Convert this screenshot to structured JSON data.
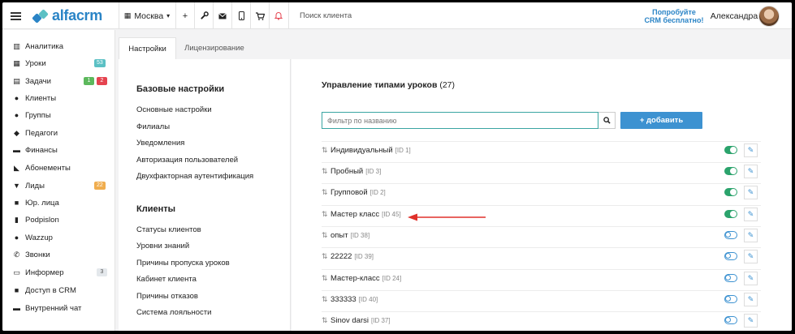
{
  "header": {
    "logo_text": "alfacrm",
    "branch": "Москва",
    "branch_caret": "▾",
    "plus": "+",
    "search_placeholder": "Поиск клиента",
    "promo_line1": "Попробуйте",
    "promo_line2": "CRM бесплатно!",
    "user_name": "Александра"
  },
  "sidebar": {
    "items": [
      {
        "label": "Аналитика",
        "icon": "analytics-icon",
        "glyph": "▥"
      },
      {
        "label": "Уроки",
        "icon": "calendar-icon",
        "glyph": "▦",
        "badge": "53"
      },
      {
        "label": "Задачи",
        "icon": "tasks-icon",
        "glyph": "▤",
        "badge1": "1",
        "badge2": "2"
      },
      {
        "label": "Клиенты",
        "icon": "user-icon",
        "glyph": "●"
      },
      {
        "label": "Группы",
        "icon": "users-icon",
        "glyph": "●"
      },
      {
        "label": "Педагоги",
        "icon": "graduation-cap-icon",
        "glyph": "◆"
      },
      {
        "label": "Финансы",
        "icon": "money-icon",
        "glyph": "▬"
      },
      {
        "label": "Абонементы",
        "icon": "tag-icon",
        "glyph": "◣"
      },
      {
        "label": "Лиды",
        "icon": "funnel-icon",
        "glyph": "▼",
        "badge": "22"
      },
      {
        "label": "Юр. лица",
        "icon": "briefcase-icon",
        "glyph": "■"
      },
      {
        "label": "Podpislon",
        "icon": "document-icon",
        "glyph": "▮"
      },
      {
        "label": "Wazzup",
        "icon": "whatsapp-icon",
        "glyph": "●"
      },
      {
        "label": "Звонки",
        "icon": "phone-icon",
        "glyph": "✆"
      },
      {
        "label": "Информер",
        "icon": "informer-icon",
        "glyph": "▭",
        "badge": "3"
      },
      {
        "label": "Доступ в CRM",
        "icon": "lock-icon",
        "glyph": "■"
      },
      {
        "label": "Внутренний чат",
        "icon": "chat-icon",
        "glyph": "▬"
      }
    ]
  },
  "tabs": [
    {
      "label": "Настройки"
    },
    {
      "label": "Лицензирование"
    }
  ],
  "settings": {
    "base_title": "Базовые настройки",
    "base_links": [
      "Основные настройки",
      "Филиалы",
      "Уведомления",
      "Авторизация пользователей",
      "Двухфакторная аутентификация"
    ],
    "clients_title": "Клиенты",
    "clients_links": [
      "Статусы клиентов",
      "Уровни знаний",
      "Причины пропуска уроков",
      "Кабинет клиента",
      "Причины отказов",
      "Система лояльности"
    ]
  },
  "content": {
    "title": "Управление типами уроков",
    "count": "(27)",
    "filter_placeholder": "Фильтр по названию",
    "add_label": "+ добавить",
    "rows": [
      {
        "name": "Индивидуальный",
        "id": "[ID 1]",
        "active": true
      },
      {
        "name": "Пробный",
        "id": "[ID 3]",
        "active": true
      },
      {
        "name": "Групповой",
        "id": "[ID 2]",
        "active": true
      },
      {
        "name": "Мастер класс",
        "id": "[ID 45]",
        "active": true
      },
      {
        "name": "опыт",
        "id": "[ID 38]",
        "active": false
      },
      {
        "name": "22222",
        "id": "[ID 39]",
        "active": false
      },
      {
        "name": "Мастер-класс",
        "id": "[ID 24]",
        "active": false
      },
      {
        "name": "333333",
        "id": "[ID 40]",
        "active": false
      },
      {
        "name": "Sinov darsi",
        "id": "[ID 37]",
        "active": false
      }
    ]
  },
  "colors": {
    "accent": "#2a84c6",
    "teal": "#5bc0c4",
    "green": "#5cb85c",
    "red": "#e5434f",
    "orange": "#f0ad4e",
    "toggle_on": "#2ba36c",
    "arrow": "#e0312b"
  }
}
